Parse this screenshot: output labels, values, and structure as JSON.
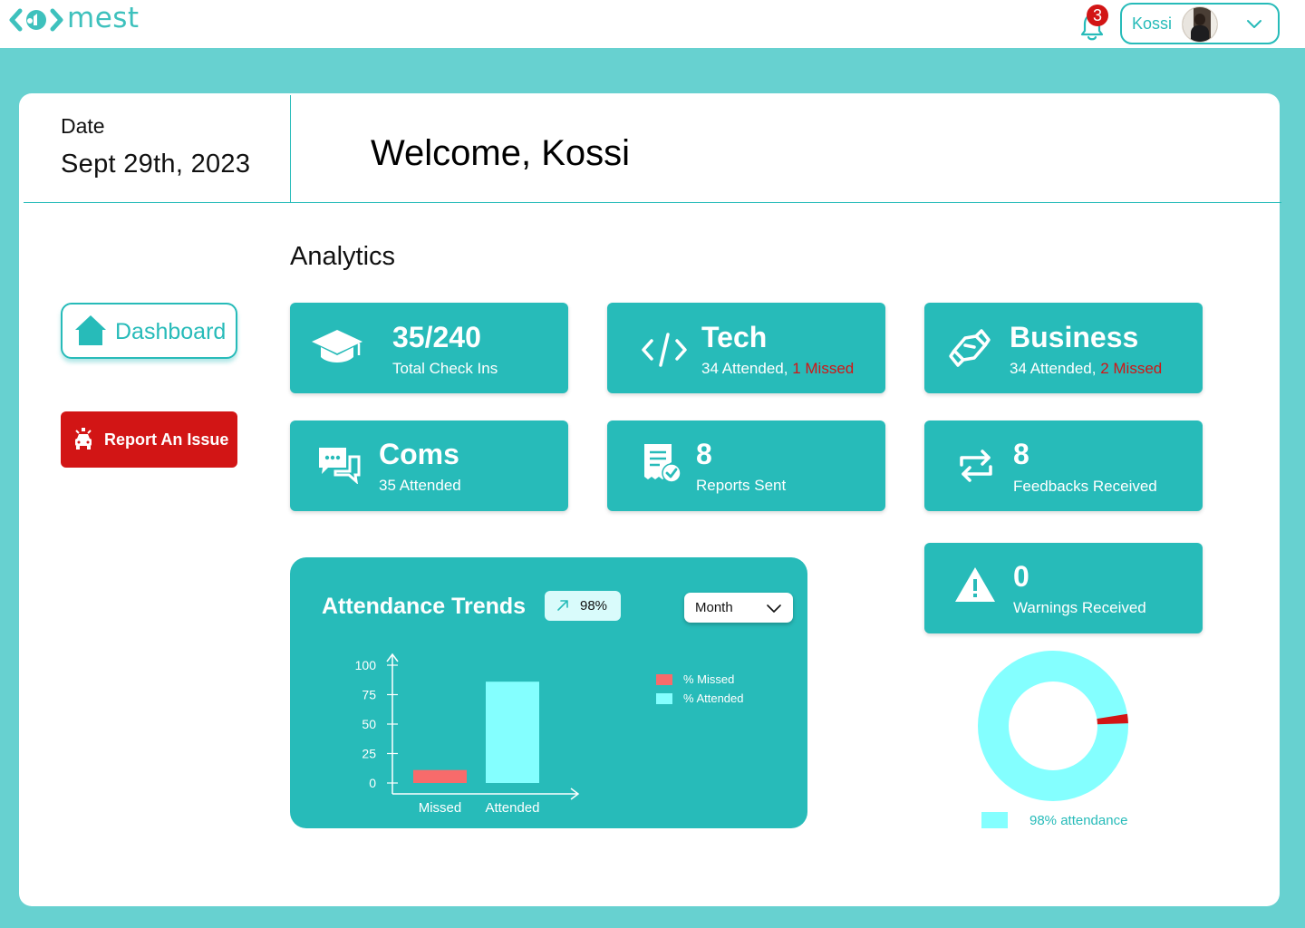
{
  "brand": {
    "name": "mest",
    "accent": "#27BBB9",
    "background": "#67D1D0",
    "alert": "#D21515"
  },
  "topbar": {
    "notifications_count": "3",
    "user_name": "Kossi",
    "icons": [
      "bell-icon",
      "chevron-down-icon",
      "avatar"
    ]
  },
  "header": {
    "date_label": "Date",
    "date_value": "Sept 29th, 2023",
    "welcome": "Welcome, Kossi"
  },
  "sidebar": {
    "dashboard_label": "Dashboard",
    "report_label": "Report An Issue"
  },
  "analytics": {
    "title": "Analytics",
    "tiles": [
      {
        "icon": "graduation-cap-icon",
        "main": "35/240",
        "sub": "Total Check Ins"
      },
      {
        "icon": "code-icon",
        "main": "Tech",
        "sub": "34 Attended, ",
        "missed": "1 Missed"
      },
      {
        "icon": "handshake-icon",
        "main": "Business",
        "sub": "34 Attended, ",
        "missed": "2 Missed"
      },
      {
        "icon": "chat-icon",
        "main": "Coms",
        "sub": "35 Attended"
      },
      {
        "icon": "report-icon",
        "main": "8",
        "sub": "Reports Sent"
      },
      {
        "icon": "exchange-icon",
        "main": "8",
        "sub": "Feedbacks Received"
      },
      {
        "icon": "warning-icon",
        "main": "0",
        "sub": "Warnings Received"
      }
    ]
  },
  "attendance_panel": {
    "title": "Attendance Trends",
    "trend_value": "98%",
    "period_select": "Month",
    "legend": [
      {
        "label": "% Missed",
        "color": "#F76B6B"
      },
      {
        "label": "% Attended",
        "color": "#84FFFF"
      }
    ]
  },
  "donut": {
    "legend_label": "98% attendance",
    "attended_percent": 98,
    "missed_percent": 2,
    "attended_color": "#84FFFF",
    "missed_color": "#D21515"
  },
  "chart_data": {
    "type": "bar",
    "categories": [
      "Missed",
      "Attended"
    ],
    "values": [
      11,
      86
    ],
    "colors": [
      "#F76B6B",
      "#84FFFF"
    ],
    "y_ticks": [
      "100",
      "75",
      "50",
      "25",
      "0"
    ],
    "ylim": [
      0,
      100
    ],
    "xlabel": "",
    "ylabel": ""
  }
}
